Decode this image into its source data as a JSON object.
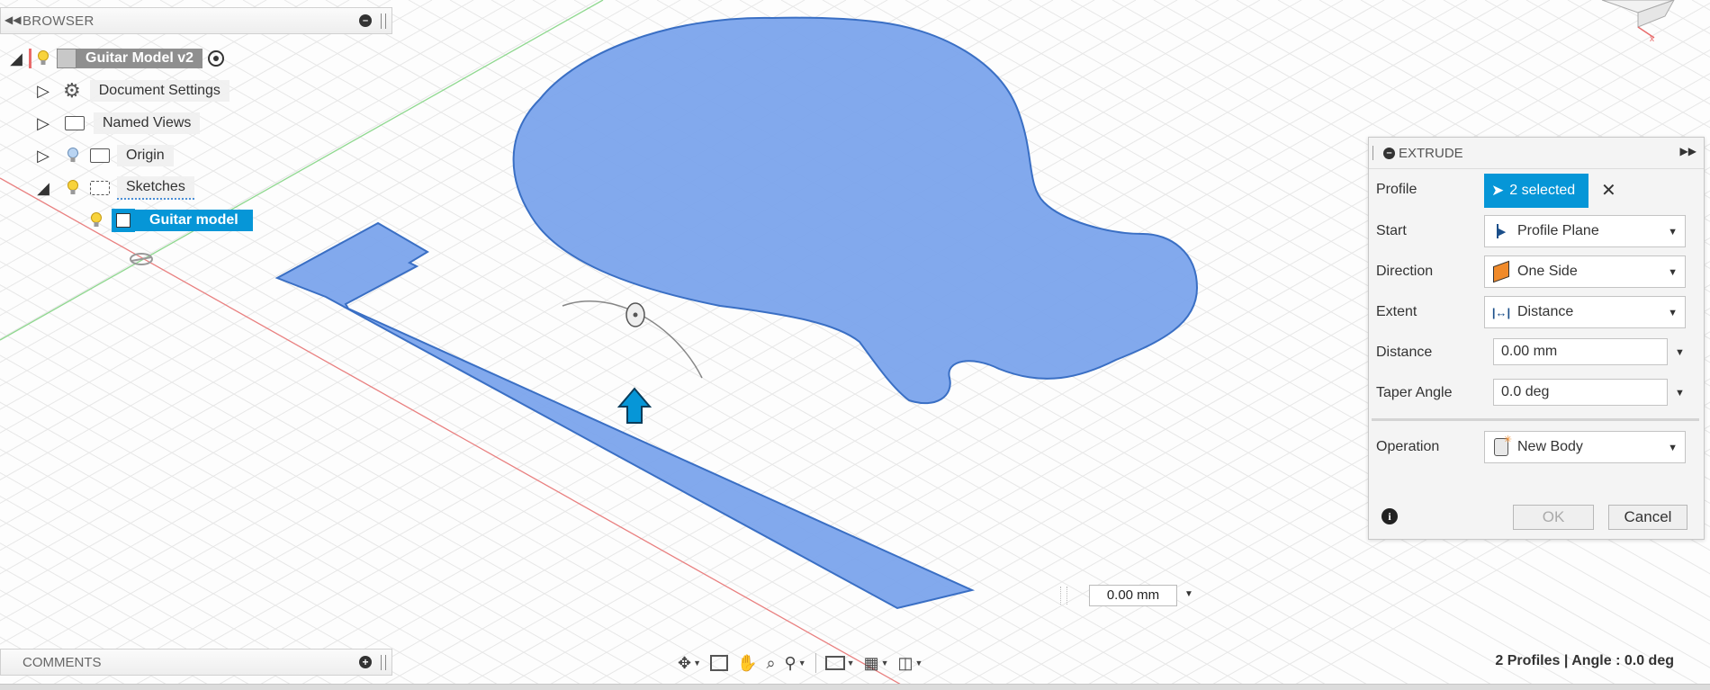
{
  "browser": {
    "title": "BROWSER",
    "root_label": "Guitar Model v2",
    "items": [
      {
        "label": "Document Settings"
      },
      {
        "label": "Named Views"
      },
      {
        "label": "Origin"
      },
      {
        "label": "Sketches"
      }
    ],
    "sketch_label": "Guitar model"
  },
  "comments": {
    "title": "COMMENTS"
  },
  "extrude": {
    "title": "EXTRUDE",
    "profile_label": "Profile",
    "profile_value": "2 selected",
    "start_label": "Start",
    "start_value": "Profile Plane",
    "direction_label": "Direction",
    "direction_value": "One Side",
    "extent_label": "Extent",
    "extent_value": "Distance",
    "distance_label": "Distance",
    "distance_value": "0.00 mm",
    "taper_label": "Taper Angle",
    "taper_value": "0.0 deg",
    "operation_label": "Operation",
    "operation_value": "New Body",
    "ok_label": "OK",
    "cancel_label": "Cancel"
  },
  "viewport": {
    "distance_input": "0.00 mm"
  },
  "status": "2 Profiles | Angle : 0.0 deg",
  "colors": {
    "profile_fill": "#7ba4ec",
    "profile_stroke": "#3a6fc4",
    "selection": "#0696d7",
    "x_axis": "#e86a6a",
    "y_axis": "#7bd07b"
  },
  "icons": [
    "collapse-icon",
    "minimize-icon",
    "bulb-icon",
    "component-icon",
    "target-icon",
    "gear-icon",
    "folder-icon",
    "sketch-icon",
    "cursor-icon",
    "close-icon",
    "pan-icon",
    "look-at-icon",
    "hand-icon",
    "zoom-icon",
    "fit-icon",
    "display-icon",
    "grid-icon",
    "viewports-icon",
    "info-icon",
    "arrow-up-icon"
  ]
}
